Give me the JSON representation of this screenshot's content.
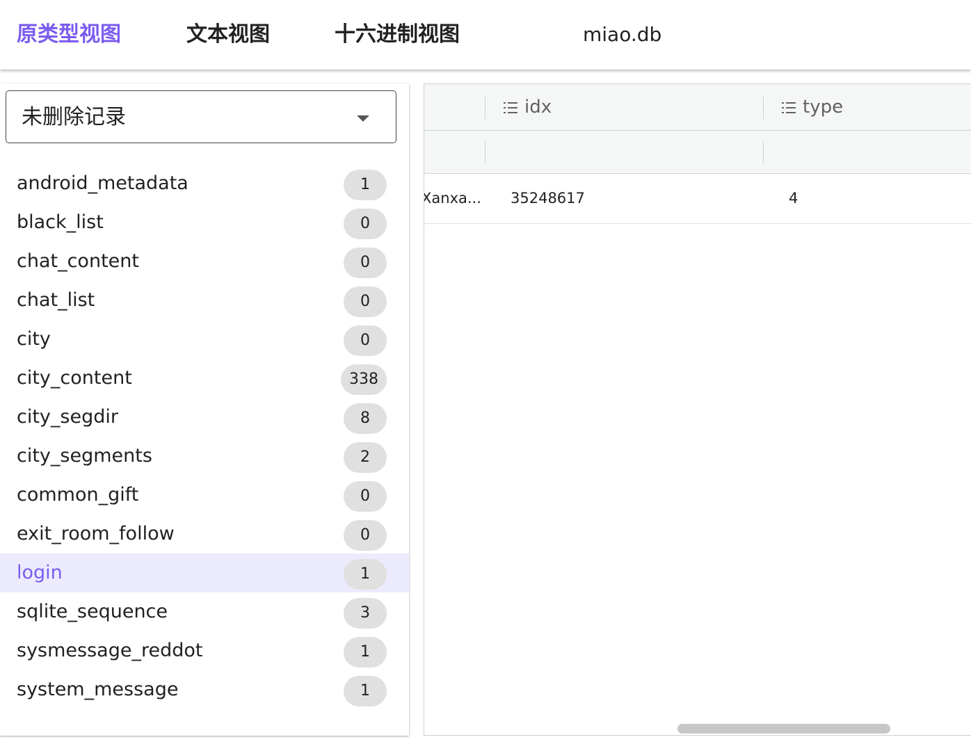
{
  "tabs": [
    {
      "label": "原类型视图",
      "active": true
    },
    {
      "label": "文本视图",
      "active": false
    },
    {
      "label": "十六进制视图",
      "active": false
    }
  ],
  "db_name": "miao.db",
  "filter": {
    "selected": "未删除记录"
  },
  "tables": [
    {
      "name": "android_metadata",
      "count": "1"
    },
    {
      "name": "black_list",
      "count": "0"
    },
    {
      "name": "chat_content",
      "count": "0"
    },
    {
      "name": "chat_list",
      "count": "0"
    },
    {
      "name": "city",
      "count": "0"
    },
    {
      "name": "city_content",
      "count": "338"
    },
    {
      "name": "city_segdir",
      "count": "8"
    },
    {
      "name": "city_segments",
      "count": "2"
    },
    {
      "name": "common_gift",
      "count": "0"
    },
    {
      "name": "exit_room_follow",
      "count": "0"
    },
    {
      "name": "login",
      "count": "1",
      "selected": true
    },
    {
      "name": "sqlite_sequence",
      "count": "3"
    },
    {
      "name": "sysmessage_reddot",
      "count": "1"
    },
    {
      "name": "system_message",
      "count": "1"
    }
  ],
  "grid": {
    "columns": [
      "idx",
      "type"
    ],
    "rows": [
      {
        "truncated": "Xanxa...",
        "idx": "35248617",
        "type": "4"
      }
    ]
  },
  "colors": {
    "accent": "#7b5cf0",
    "selected_row_bg": "#ecebfd",
    "badge_bg": "#e0e0e0"
  }
}
